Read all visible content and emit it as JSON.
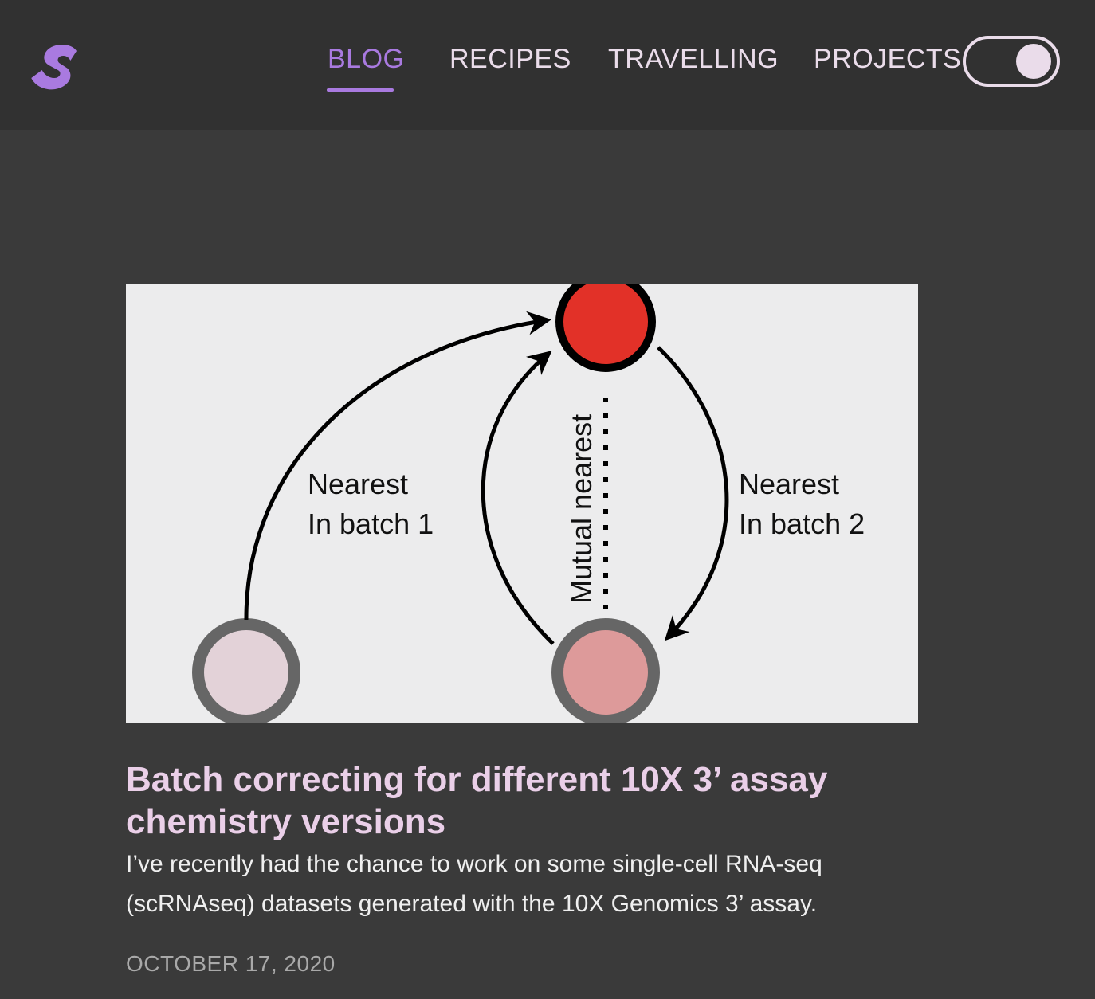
{
  "nav": {
    "items": [
      {
        "label": "BLOG",
        "active": true
      },
      {
        "label": "RECIPES",
        "active": false
      },
      {
        "label": "TRAVELLING",
        "active": false
      },
      {
        "label": "PROJECTS",
        "active": false
      }
    ],
    "theme_toggle": {
      "state": "on"
    }
  },
  "colors": {
    "accent": "#a97ae0",
    "title": "#eacfe8",
    "nav_text": "#eadcea",
    "background": "#3a3a3a",
    "header_background": "#313131"
  },
  "post": {
    "image": {
      "label_left_line1": "Nearest",
      "label_left_line2": "In batch 1",
      "label_center": "Mutual nearest",
      "label_right_line1": "Nearest",
      "label_right_line2": "In batch 2"
    },
    "title": "Batch correcting for different 10X 3’ assay chemistry versions",
    "excerpt": "I’ve recently had the chance to work on some single-cell RNA-seq (scRNAseq) datasets generated with the 10X Genomics 3’ assay.",
    "date": "OCTOBER 17, 2020"
  },
  "icons": {
    "logo": "s-logo-icon",
    "toggle": "theme-toggle"
  }
}
